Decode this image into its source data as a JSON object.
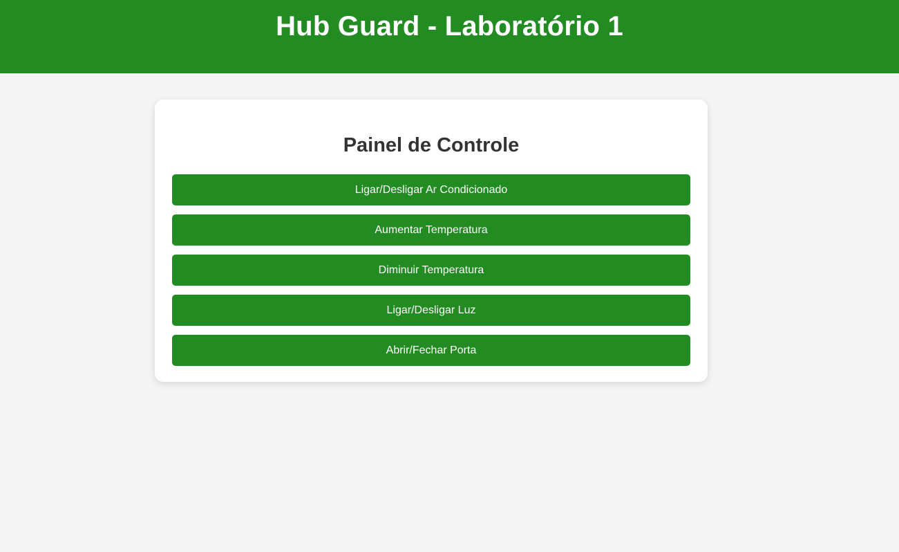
{
  "header": {
    "title": "Hub Guard - Laboratório 1"
  },
  "panel": {
    "title": "Painel de Controle",
    "buttons": [
      {
        "label": "Ligar/Desligar Ar Condicionado"
      },
      {
        "label": "Aumentar Temperatura"
      },
      {
        "label": "Diminuir Temperatura"
      },
      {
        "label": "Ligar/Desligar Luz"
      },
      {
        "label": "Abrir/Fechar Porta"
      }
    ]
  },
  "colors": {
    "accent": "#228b22",
    "background": "#f4f4f4",
    "card": "#ffffff",
    "heading_text": "#333333"
  }
}
